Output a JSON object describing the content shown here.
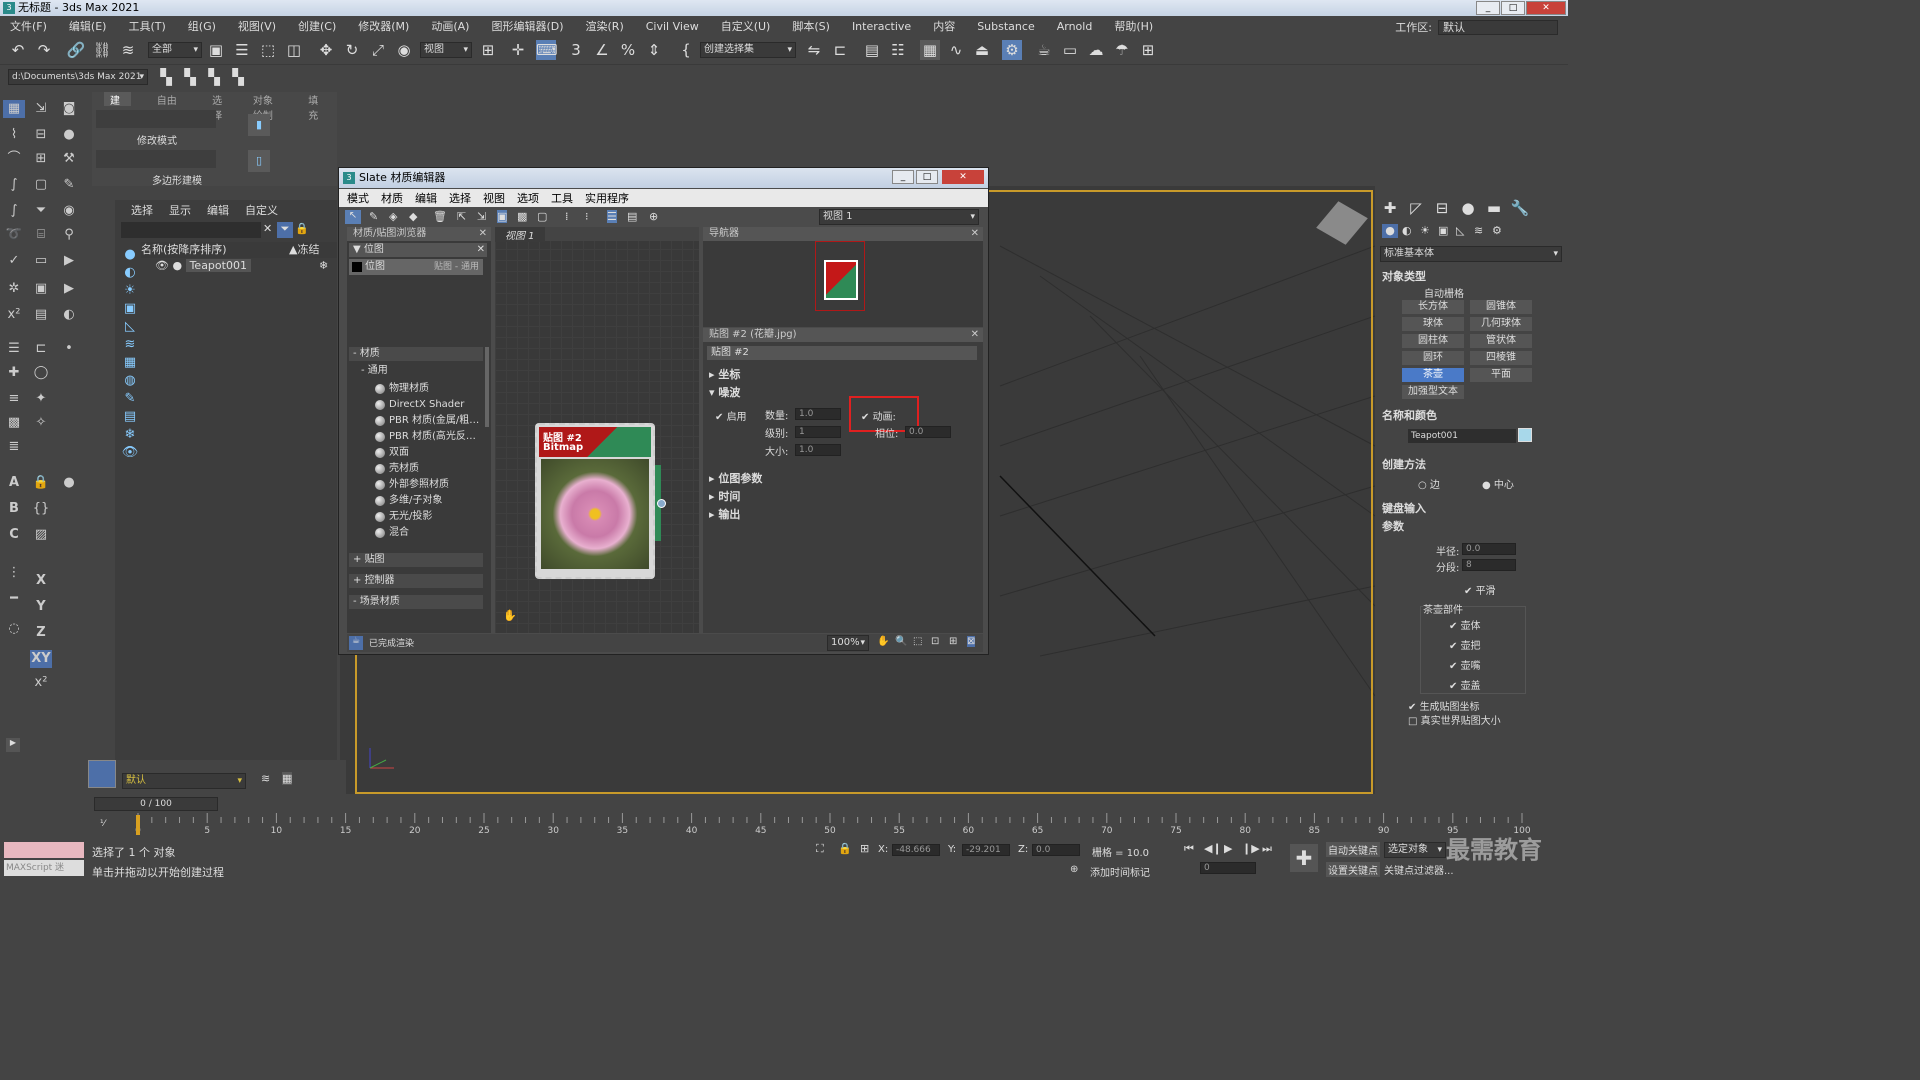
{
  "window": {
    "title": "无标题 - 3ds Max 2021",
    "minimize": "_",
    "maximize": "□",
    "close": "✕"
  },
  "menubar": [
    "文件(F)",
    "编辑(E)",
    "工具(T)",
    "组(G)",
    "视图(V)",
    "创建(C)",
    "修改器(M)",
    "动画(A)",
    "图形编辑器(D)",
    "渲染(R)",
    "Civil View",
    "自定义(U)",
    "脚本(S)",
    "Interactive",
    "内容",
    "Substance",
    "Arnold",
    "帮助(H)"
  ],
  "workspace": {
    "label": "工作区:",
    "value": "默认"
  },
  "toolbar": {
    "selection_filter": "全部",
    "reference_coord": "视图",
    "named_selection": "创建选择集"
  },
  "path_box": "d:\\Documents\\3ds Max 2021",
  "ribbon": {
    "tabs": [
      "建模",
      "自由形式",
      "选择",
      "对象绘制",
      "填充"
    ],
    "modify_mode": "修改模式",
    "poly_modeling": "多边形建模"
  },
  "scene_explorer": {
    "menu": [
      "选择",
      "显示",
      "编辑",
      "自定义"
    ],
    "col_name": "名称(按降序排序)",
    "col_frozen": "▲冻结",
    "objects": [
      "Teapot001"
    ]
  },
  "layer": {
    "name": "默认"
  },
  "slate": {
    "title": "Slate 材质编辑器",
    "menu": [
      "模式",
      "材质",
      "编辑",
      "选择",
      "视图",
      "选项",
      "工具",
      "实用程序"
    ],
    "view_combo": "视图 1",
    "browser_title": "材质/贴图浏览器",
    "search_group": "位图",
    "search_result": "位图",
    "search_result_type": "贴图 - 通用",
    "groups": {
      "materials": "材质",
      "general": "通用",
      "maps": "贴图",
      "controllers": "控制器",
      "scene_materials": "场景材质"
    },
    "materials": [
      "物理材质",
      "DirectX Shader",
      "PBR 材质(金属/粗…",
      "PBR 材质(高光反…",
      "双面",
      "壳材质",
      "外部参照材质",
      "多维/子对象",
      "无光/投影",
      "混合"
    ],
    "view_tab": "视图 1",
    "node": {
      "title_line1": "贴图 #2",
      "title_line2": "Bitmap"
    },
    "navigator_title": "导航器",
    "props_title": "贴图 #2 (花瓣.jpg)",
    "props_name": "贴图 #2",
    "rollouts": {
      "coords": "坐标",
      "noise": "噪波",
      "bitmap_params": "位图参数",
      "time": "时间",
      "output": "输出"
    },
    "noise": {
      "enable_label": "启用",
      "enable": true,
      "amount_label": "数量:",
      "amount": "1.0",
      "levels_label": "级别:",
      "levels": "1",
      "size_label": "大小:",
      "size": "1.0",
      "animate_label": "动画:",
      "animate": true,
      "phase_label": "相位:",
      "phase": "0.0"
    },
    "status": "已完成渲染",
    "zoom": "100%"
  },
  "command_panel": {
    "category": "标准基本体",
    "object_type": "对象类型",
    "autogrid": "自动栅格",
    "buttons": [
      "长方体",
      "圆锥体",
      "球体",
      "几何球体",
      "圆柱体",
      "管状体",
      "圆环",
      "四棱锥",
      "茶壶",
      "平面",
      "加强型文本"
    ],
    "active_button": "茶壶",
    "name_color": "名称和颜色",
    "object_name": "Teapot001",
    "creation_method": "创建方法",
    "edge": "边",
    "center": "中心",
    "keyboard_entry": "键盘输入",
    "params": "参数",
    "radius_label": "半径:",
    "radius": "0.0",
    "segments_label": "分段:",
    "segments": "8",
    "smooth": "平滑",
    "teapot_parts": "茶壶部件",
    "parts": [
      "壶体",
      "壶把",
      "壶嘴",
      "壶盖"
    ],
    "gen_map_coords": "生成贴图坐标",
    "real_world": "真实世界贴图大小"
  },
  "timeline": {
    "frame": "0 / 100",
    "ticks": [
      "0",
      "5",
      "10",
      "15",
      "20",
      "25",
      "30",
      "35",
      "40",
      "45",
      "50",
      "55",
      "60",
      "65",
      "70",
      "75",
      "80",
      "85",
      "90",
      "95",
      "100"
    ]
  },
  "status": {
    "maxscript": "MAXScript 迷",
    "selected": "选择了 1 个 对象",
    "prompt": "单击并拖动以开始创建过程",
    "x_label": "X:",
    "x": "-48.666",
    "y_label": "Y:",
    "y": "-29.201",
    "z_label": "Z:",
    "z": "0.0",
    "grid": "栅格 = 10.0",
    "add_time_tag": "添加时间标记",
    "auto_key": "自动关键点",
    "set_key": "设置关键点",
    "selected_obj": "选定对象",
    "key_filters": "关键点过滤器...",
    "frame_field": "0",
    "watermark": "最需教育"
  }
}
